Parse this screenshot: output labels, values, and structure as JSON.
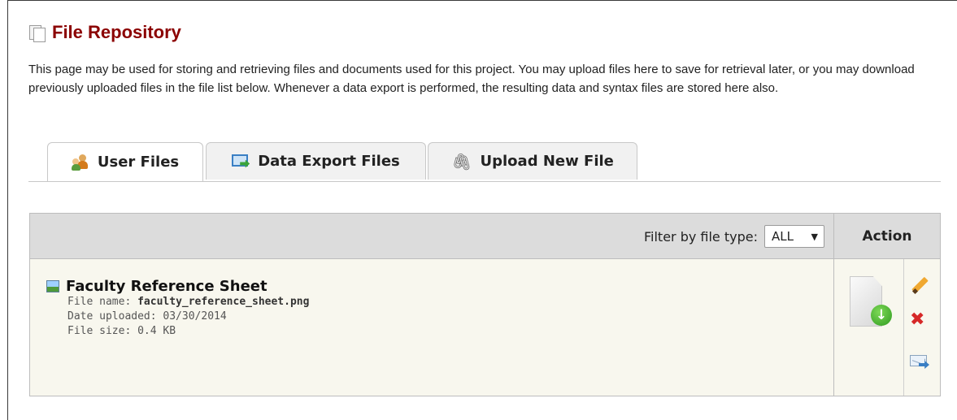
{
  "page": {
    "title": "File Repository",
    "title_icon": "documents-icon",
    "intro": "This page may be used for storing and retrieving files and documents used for this project. You may upload files here to save for retrieval later, or you may download previously uploaded files in the file list below. Whenever a data export is performed, the resulting data and syntax files are stored here also."
  },
  "tabs": [
    {
      "label": "User Files",
      "icon": "users-icon",
      "active": true
    },
    {
      "label": "Data Export Files",
      "icon": "data-export-icon",
      "active": false
    },
    {
      "label": "Upload New File",
      "icon": "paperclip-icon",
      "active": false
    }
  ],
  "table": {
    "filter_label": "Filter by file type:",
    "filter_value": "ALL",
    "action_header": "Action",
    "files": [
      {
        "title": "Faculty Reference Sheet",
        "file_name_label": "File name:",
        "file_name": "faculty_reference_sheet.png",
        "date_label": "Date uploaded:",
        "date": "03/30/2014",
        "size_label": "File size:",
        "size": "0.4 KB",
        "icon": "image-file-icon"
      }
    ]
  },
  "colors": {
    "title": "#8b0000",
    "header_bg": "#dcdcdc",
    "row_bg": "#f8f7ee",
    "delete": "#d62828"
  }
}
